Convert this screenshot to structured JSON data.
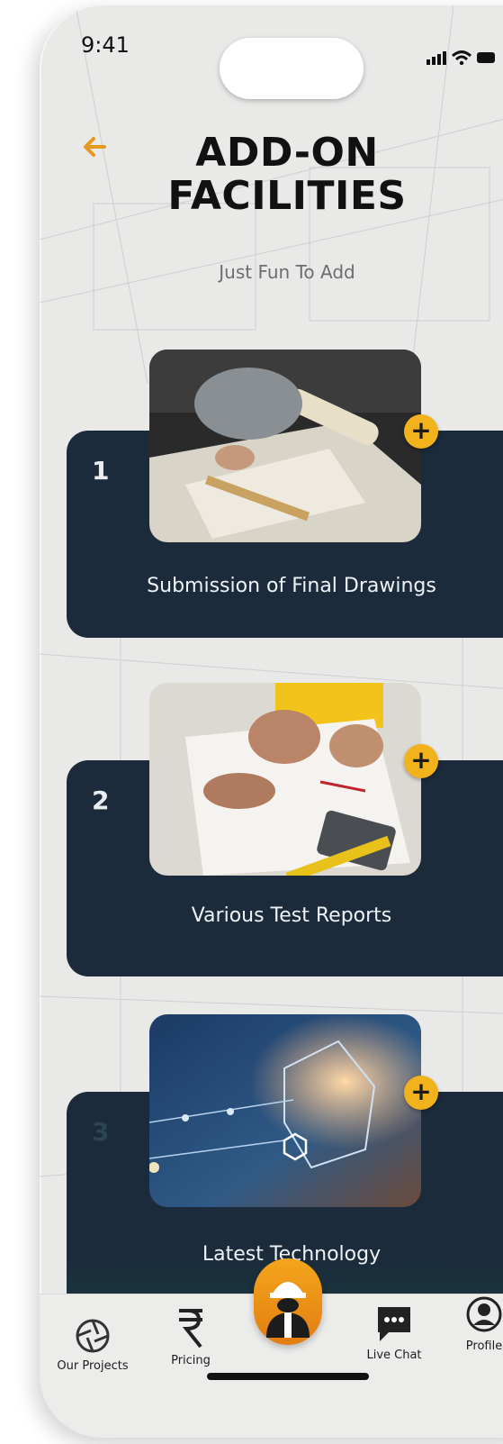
{
  "status": {
    "time": "9:41"
  },
  "header": {
    "title_line1": "ADD-ON",
    "title_line2": "FACILITIES",
    "subtitle": "Just Fun To Add"
  },
  "facilities": [
    {
      "number": "1",
      "label": "Submission of Final Drawings",
      "add_symbol": "+"
    },
    {
      "number": "2",
      "label": "Various Test Reports",
      "add_symbol": "+"
    },
    {
      "number": "3",
      "label": "Latest Technology",
      "add_symbol": "+"
    }
  ],
  "tabbar": {
    "items": [
      {
        "label": "Our Projects",
        "icon": "aperture-icon"
      },
      {
        "label": "Pricing",
        "icon": "rupee-icon"
      },
      {
        "label": "",
        "icon": "engineer-icon"
      },
      {
        "label": "Live Chat",
        "icon": "chat-bubble-icon"
      },
      {
        "label": "Profile",
        "icon": "profile-icon"
      }
    ]
  },
  "colors": {
    "accent": "#f2b21b",
    "card": "#1b2b3b",
    "back_arrow": "#e69a1c"
  }
}
